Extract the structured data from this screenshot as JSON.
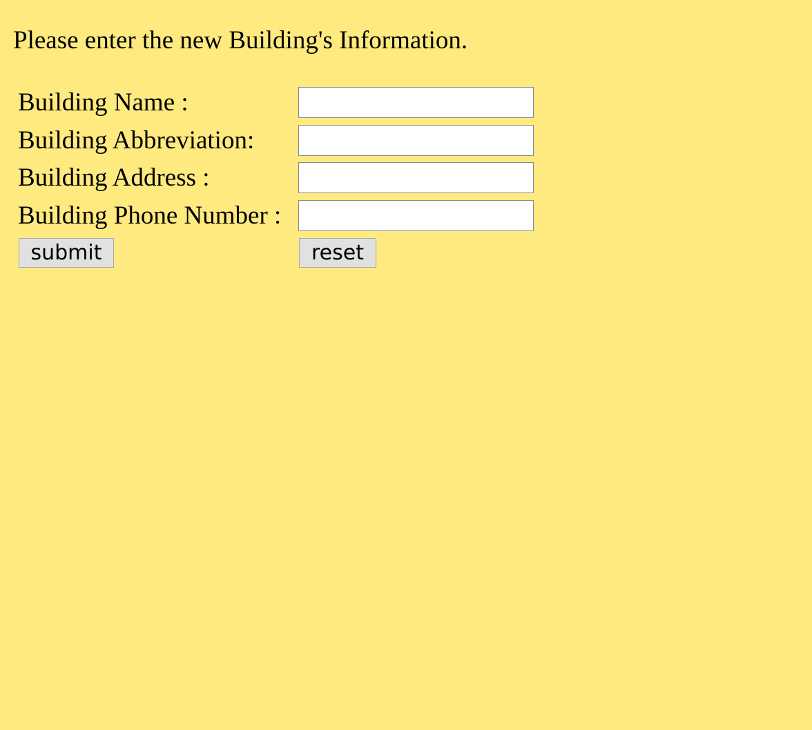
{
  "page": {
    "title": "Please enter the new Building's Information.",
    "background_color": "#ffea80"
  },
  "form": {
    "fields": [
      {
        "label": "Building Name :",
        "value": "",
        "placeholder": ""
      },
      {
        "label": "Building Abbreviation:",
        "value": "",
        "placeholder": ""
      },
      {
        "label": "Building Address :",
        "value": "",
        "placeholder": ""
      },
      {
        "label": "Building Phone Number :",
        "value": "",
        "placeholder": ""
      }
    ],
    "submit_label": "submit",
    "reset_label": "reset"
  }
}
